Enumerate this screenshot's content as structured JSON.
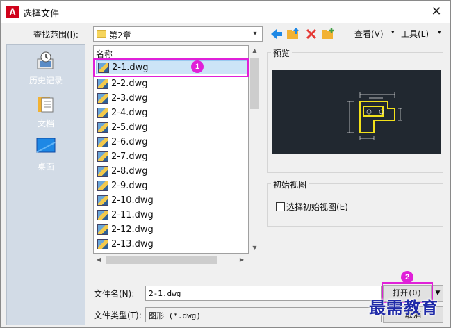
{
  "window": {
    "title": "选择文件",
    "app_icon": "A"
  },
  "lookin": {
    "label": "查找范围(I):",
    "value": "第2章"
  },
  "toolbar": {
    "view_label": "查看(V)",
    "tools_label": "工具(L)"
  },
  "places": [
    {
      "label": "历史记录",
      "icon": "history-icon"
    },
    {
      "label": "文档",
      "icon": "documents-icon"
    },
    {
      "label": "桌面",
      "icon": "desktop-icon"
    }
  ],
  "filelist": {
    "column_header": "名称",
    "files": [
      "2-1.dwg",
      "2-2.dwg",
      "2-3.dwg",
      "2-4.dwg",
      "2-5.dwg",
      "2-6.dwg",
      "2-7.dwg",
      "2-8.dwg",
      "2-9.dwg",
      "2-10.dwg",
      "2-11.dwg",
      "2-12.dwg",
      "2-13.dwg"
    ],
    "selected_index": 0
  },
  "preview": {
    "label": "预览"
  },
  "initial_view": {
    "label": "初始视图",
    "checkbox_label": "选择初始视图(E)",
    "checked": false
  },
  "filename": {
    "label": "文件名(N):",
    "value": "2-1.dwg"
  },
  "filetype": {
    "label": "文件类型(T):",
    "value": "图形 (*.dwg)"
  },
  "buttons": {
    "open_label": "打开(O)",
    "cancel_label": "取消"
  },
  "annotations": {
    "step1": "1",
    "step2": "2",
    "color": "#e020d8"
  },
  "watermark": "最需教育"
}
